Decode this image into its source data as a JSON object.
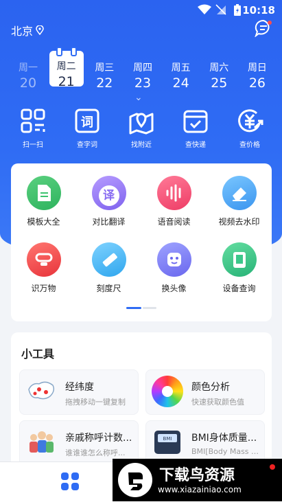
{
  "status": {
    "time": "10:18"
  },
  "header": {
    "city": "北京"
  },
  "week": [
    {
      "w": "周一",
      "d": "20",
      "state": "past"
    },
    {
      "w": "周二",
      "d": "21",
      "state": "sel"
    },
    {
      "w": "周三",
      "d": "22",
      "state": ""
    },
    {
      "w": "周四",
      "d": "23",
      "state": ""
    },
    {
      "w": "周五",
      "d": "24",
      "state": ""
    },
    {
      "w": "周六",
      "d": "25",
      "state": ""
    },
    {
      "w": "周日",
      "d": "26",
      "state": ""
    }
  ],
  "tools": [
    {
      "label": "扫一扫",
      "icon": "scan-icon"
    },
    {
      "label": "查字词",
      "icon": "dictionary-icon"
    },
    {
      "label": "找附近",
      "icon": "map-pin-icon"
    },
    {
      "label": "查快递",
      "icon": "package-icon"
    },
    {
      "label": "查价格",
      "icon": "price-icon"
    }
  ],
  "features": [
    {
      "label": "模板大全",
      "icon": "document-icon",
      "color": "#3cc36e",
      "glyph": ""
    },
    {
      "label": "对比翻译",
      "icon": "translate-icon",
      "color": "#9a7cf5",
      "glyph": "译"
    },
    {
      "label": "语音阅读",
      "icon": "waveform-icon",
      "color": "#f24d73",
      "glyph": ""
    },
    {
      "label": "视频去水印",
      "icon": "eraser-icon",
      "color": "#4aa7f3",
      "glyph": ""
    },
    {
      "label": "识万物",
      "icon": "object-icon",
      "color": "#f2474a",
      "glyph": ""
    },
    {
      "label": "刻度尺",
      "icon": "ruler-icon",
      "color": "#3fb3f0",
      "glyph": ""
    },
    {
      "label": "换头像",
      "icon": "avatar-icon",
      "color": "#7a77f2",
      "glyph": ""
    },
    {
      "label": "设备查询",
      "icon": "device-icon",
      "color": "#3cc78a",
      "glyph": ""
    }
  ],
  "small_tools": {
    "title": "小工具",
    "items": [
      {
        "title": "经纬度",
        "sub": "拖拽移动一键复制",
        "icon": "china-map-icon"
      },
      {
        "title": "颜色分析",
        "sub": "快速获取颜色值",
        "icon": "color-wheel-icon"
      },
      {
        "title": "亲戚称呼计数...",
        "sub": "谁谁谁怎么称呼...",
        "icon": "family-icon"
      },
      {
        "title": "BMI身体质量...",
        "sub": "BMI[Body Mass I...",
        "icon": "scale-icon"
      }
    ]
  },
  "watermark": {
    "title": "下载鸟资源",
    "url": "www.xiazainiao.com"
  }
}
